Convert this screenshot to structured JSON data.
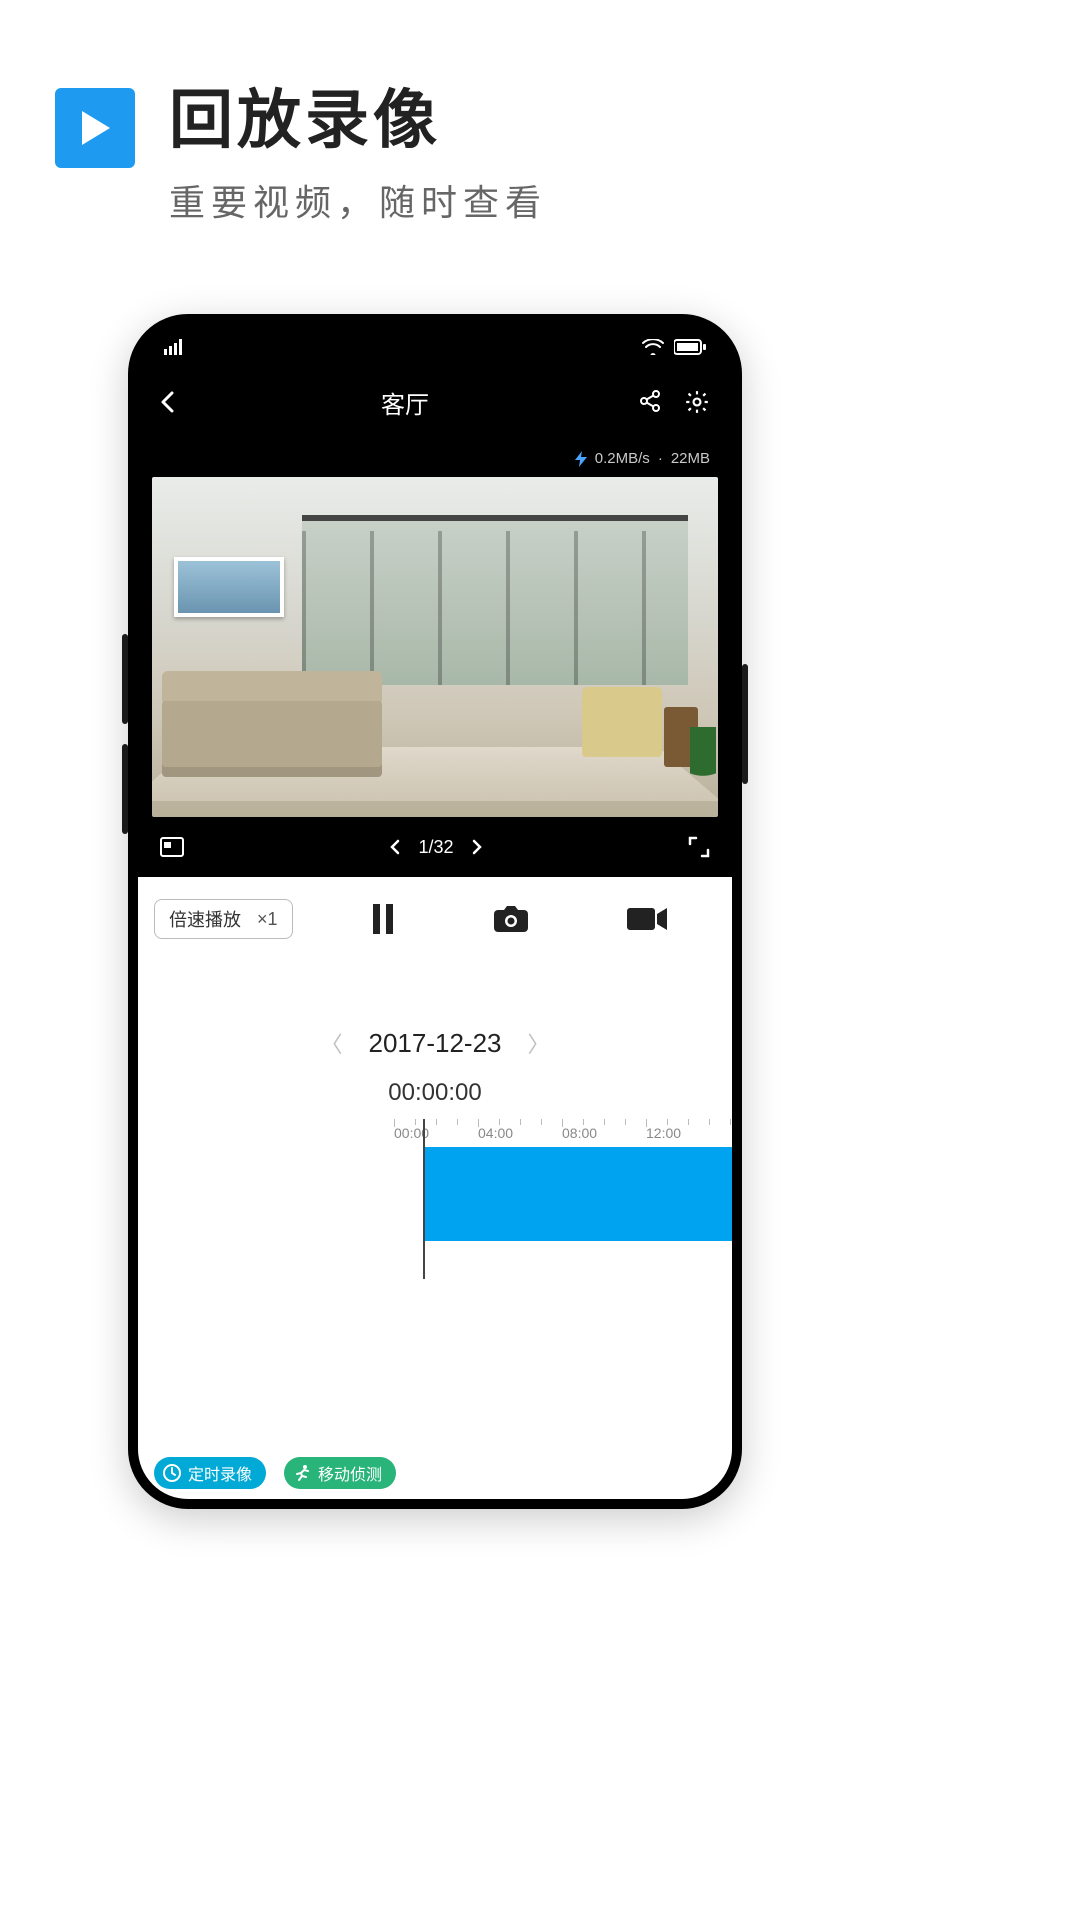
{
  "page": {
    "title": "回放录像",
    "subtitle": "重要视频，随时查看"
  },
  "colors": {
    "accent": "#1E9BF0",
    "timeline": "#00A3F0",
    "chip_blue": "#00A9D6",
    "chip_green": "#29B47A"
  },
  "app": {
    "header_title": "客厅",
    "net": {
      "speed": "0.2MB/s",
      "size": "22MB"
    },
    "pager": {
      "current": "1",
      "total": "32",
      "text": "1/32"
    },
    "speed": {
      "label": "倍速播放",
      "value": "×1"
    },
    "date": "2017-12-23",
    "timecode": "00:00:00",
    "ticks": [
      "00:00",
      "04:00",
      "08:00",
      "12:00"
    ],
    "legend": {
      "scheduled": "定时录像",
      "motion": "移动侦测"
    }
  }
}
